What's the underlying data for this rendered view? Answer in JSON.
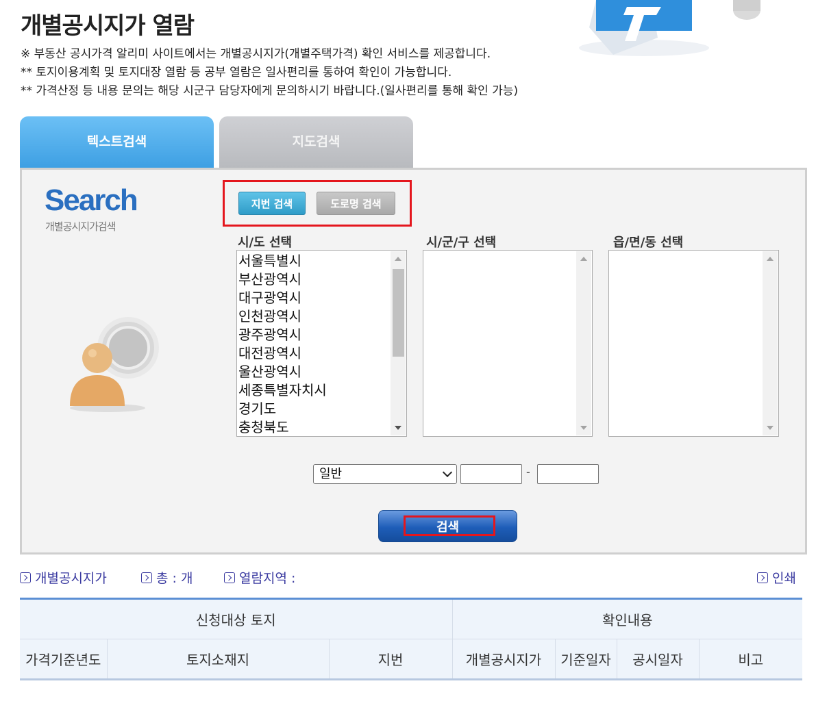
{
  "header": {
    "title": "개별공시지가 열람",
    "notes": [
      "※ 부동산 공시가격 알리미 사이트에서는 개별공시지가(개별주택가격) 확인 서비스를 제공합니다.",
      "** 토지이용계획 및 토지대장 열람 등 공부 열람은 일사편리를 통하여 확인이 가능합니다.",
      "** 가격산정 등 내용 문의는 해당 시군구 담당자에게 문의하시기 바랍니다.(일사편리를 통해 확인 가능)"
    ]
  },
  "tabs": {
    "text_search": "텍스트검색",
    "map_search": "지도검색"
  },
  "panel": {
    "logo": "Search",
    "logo_sub": "개별공시지가검색",
    "mode_jibun": "지번 검색",
    "mode_road": "도로명 검색",
    "sido_label": "시/도 선택",
    "sigungu_label": "시/군/구 선택",
    "eup_label": "읍/면/동 선택",
    "sido_options": [
      "서울특별시",
      "부산광역시",
      "대구광역시",
      "인천광역시",
      "광주광역시",
      "대전광역시",
      "울산광역시",
      "세종특별자치시",
      "경기도",
      "충청북도"
    ],
    "type_select": "일반",
    "dash": "-",
    "search_button": "검색"
  },
  "info_bar": {
    "land_price": "개별공시지가",
    "total": "총 : 개",
    "region": "열람지역 :",
    "print": "인쇄"
  },
  "table": {
    "group_left": "신청대상 토지",
    "group_right": "확인내용",
    "columns": [
      "가격기준년도",
      "토지소재지",
      "지번",
      "개별공시지가",
      "기준일자",
      "공시일자",
      "비고"
    ]
  }
}
